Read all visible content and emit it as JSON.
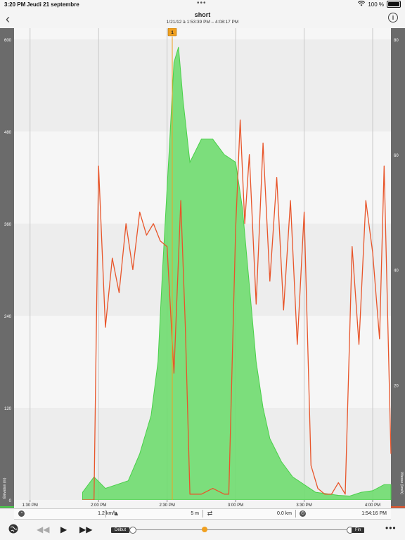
{
  "status_bar": {
    "time": "3:20 PM",
    "date": "Jeudi 21 septembre",
    "battery": "100 %"
  },
  "header": {
    "title": "short",
    "subtitle": "1/21/12 à 1:53:39 PM – 4:08:17 PM"
  },
  "marker_label": "1",
  "axes": {
    "left_label": "Élévation (m)",
    "right_label": "Vitesse (km/h)",
    "left_ticks": [
      "600",
      "480",
      "360",
      "240",
      "120",
      "0"
    ],
    "right_ticks": [
      "80",
      "60",
      "40",
      "20"
    ],
    "x_ticks": [
      "1:30 PM",
      "2:00 PM",
      "2:30 PM",
      "3:00 PM",
      "3:30 PM",
      "4:00 PM"
    ]
  },
  "stats": {
    "speed": "1.2 km/h",
    "elevation": "5 m",
    "distance": "0.0 km",
    "duration": "1:54:16 PM"
  },
  "controls": {
    "start_label": "Début",
    "end_label": "Fin"
  },
  "colors": {
    "elevation": "#6fdc6f",
    "speed": "#e8552a",
    "marker": "#f0a020"
  },
  "chart_data": {
    "type": "area",
    "x_unit": "time",
    "xlim": [
      "1:23 PM",
      "4:08 PM"
    ],
    "ylim_left": [
      0,
      600
    ],
    "ylim_right": [
      0,
      80
    ],
    "series": [
      {
        "name": "Élévation (m)",
        "axis": "left",
        "x": [
          "1:53 PM",
          "1:58 PM",
          "2:03 PM",
          "2:08 PM",
          "2:13 PM",
          "2:18 PM",
          "2:23 PM",
          "2:26 PM",
          "2:28 PM",
          "2:31 PM",
          "2:33 PM",
          "2:35 PM",
          "2:37 PM",
          "2:40 PM",
          "2:45 PM",
          "2:50 PM",
          "2:55 PM",
          "3:00 PM",
          "3:03 PM",
          "3:06 PM",
          "3:09 PM",
          "3:12 PM",
          "3:15 PM",
          "3:20 PM",
          "3:25 PM",
          "3:30 PM",
          "3:35 PM",
          "3:40 PM",
          "3:45 PM",
          "3:50 PM",
          "3:55 PM",
          "4:00 PM",
          "4:05 PM",
          "4:08 PM"
        ],
        "values": [
          10,
          30,
          15,
          20,
          25,
          60,
          110,
          180,
          300,
          460,
          570,
          590,
          520,
          440,
          470,
          470,
          450,
          440,
          380,
          280,
          180,
          120,
          80,
          50,
          30,
          20,
          10,
          8,
          6,
          5,
          10,
          12,
          20,
          20
        ]
      },
      {
        "name": "Vitesse (km/h)",
        "axis": "right",
        "x": [
          "1:53 PM",
          "1:58 PM",
          "2:00 PM",
          "2:03 PM",
          "2:06 PM",
          "2:09 PM",
          "2:12 PM",
          "2:15 PM",
          "2:18 PM",
          "2:21 PM",
          "2:24 PM",
          "2:27 PM",
          "2:30 PM",
          "2:33 PM",
          "2:36 PM",
          "2:38 PM",
          "2:40 PM",
          "2:45 PM",
          "2:50 PM",
          "2:55 PM",
          "2:57 PM",
          "3:00 PM",
          "3:02 PM",
          "3:04 PM",
          "3:06 PM",
          "3:09 PM",
          "3:12 PM",
          "3:15 PM",
          "3:18 PM",
          "3:21 PM",
          "3:24 PM",
          "3:27 PM",
          "3:30 PM",
          "3:33 PM",
          "3:36 PM",
          "3:39 PM",
          "3:42 PM",
          "3:45 PM",
          "3:48 PM",
          "3:51 PM",
          "3:54 PM",
          "3:57 PM",
          "4:00 PM",
          "4:03 PM",
          "4:05 PM",
          "4:08 PM"
        ],
        "values": [
          0,
          0,
          58,
          30,
          42,
          36,
          48,
          40,
          50,
          46,
          48,
          45,
          44,
          22,
          52,
          30,
          1,
          1,
          2,
          1,
          1,
          47,
          66,
          48,
          60,
          34,
          62,
          38,
          56,
          33,
          52,
          27,
          50,
          6,
          2,
          1,
          1,
          3,
          1,
          44,
          27,
          52,
          43,
          28,
          58,
          8
        ]
      }
    ]
  }
}
